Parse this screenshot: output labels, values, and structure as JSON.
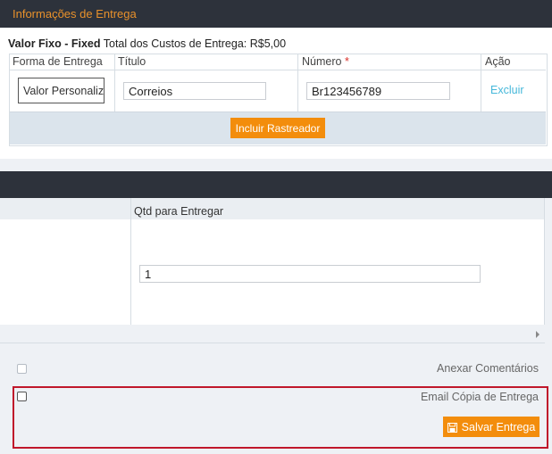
{
  "panel": {
    "title": "Informações de Entrega",
    "summary_bold": "Valor Fixo - Fixed",
    "summary_text": "Total dos Custos de Entrega: R$5,00"
  },
  "table": {
    "headers": {
      "forma": "Forma de Entrega",
      "titulo": "Título",
      "numero": "Número",
      "numero_required": "*",
      "acao": "Ação"
    },
    "row": {
      "forma": "Valor Personalizado",
      "titulo": "Correios",
      "numero": "Br123456789",
      "acao": "Excluir"
    },
    "add_button": "Incluir Rastreador"
  },
  "grid": {
    "header": "Qtd para Entregar",
    "qty_value": "1"
  },
  "options": {
    "anexar": "Anexar Comentários",
    "email": "Email Cópia de Entrega",
    "save_button": "Salvar Entrega"
  },
  "colors": {
    "accent": "#f38d0c",
    "header_bg": "#2d323b",
    "link": "#46b8da",
    "highlight": "#c0172b"
  }
}
